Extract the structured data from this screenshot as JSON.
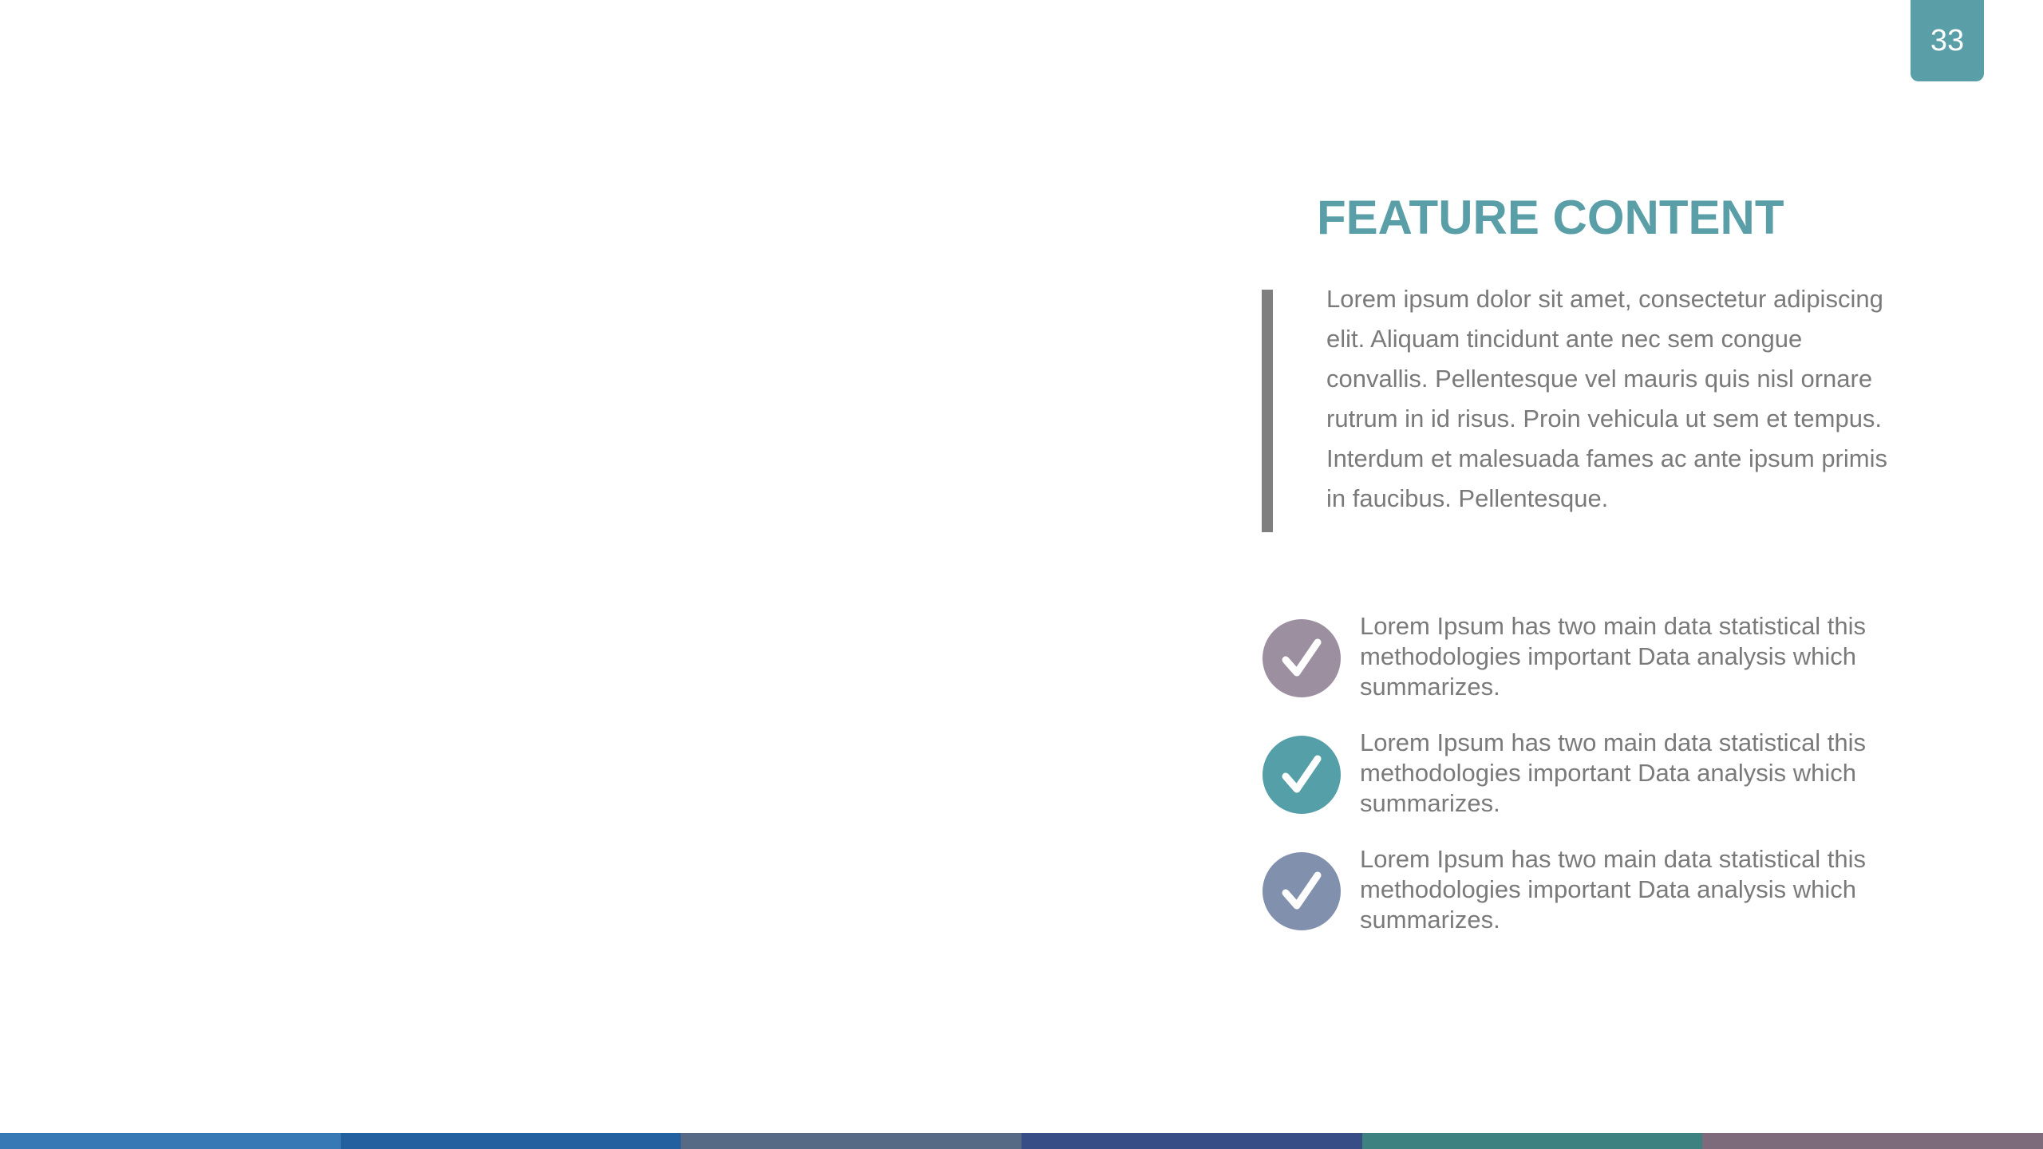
{
  "page_number": "33",
  "title": "FEATURE CONTENT",
  "intro": "Lorem ipsum dolor sit amet, consectetur adipiscing elit. Aliquam tincidunt ante nec sem congue convallis. Pellentesque vel mauris quis nisl ornare rutrum in id risus. Proin vehicula ut sem et tempus. Interdum et malesuada fames ac ante ipsum primis in faucibus. Pellentesque.",
  "features": [
    {
      "text": "Lorem Ipsum has two main data statistical this methodologies important Data analysis which summarizes.",
      "icon": "check-icon",
      "color": "#9b8fa0"
    },
    {
      "text": "Lorem Ipsum has two main data statistical this methodologies important Data analysis which summarizes.",
      "icon": "check-icon",
      "color": "#55a0a8"
    },
    {
      "text": "Lorem Ipsum has two main data statistical this methodologies important Data analysis which summarizes.",
      "icon": "check-icon",
      "color": "#8190ad"
    }
  ],
  "colors": {
    "accent": "#5a9fa8",
    "quote_bar": "#7f7f7f",
    "body_text": "#7a7a7a"
  },
  "footer_colors": [
    "#3679b5",
    "#2360a0",
    "#566a86",
    "#364d86",
    "#3e8181",
    "#7d6a7b"
  ]
}
